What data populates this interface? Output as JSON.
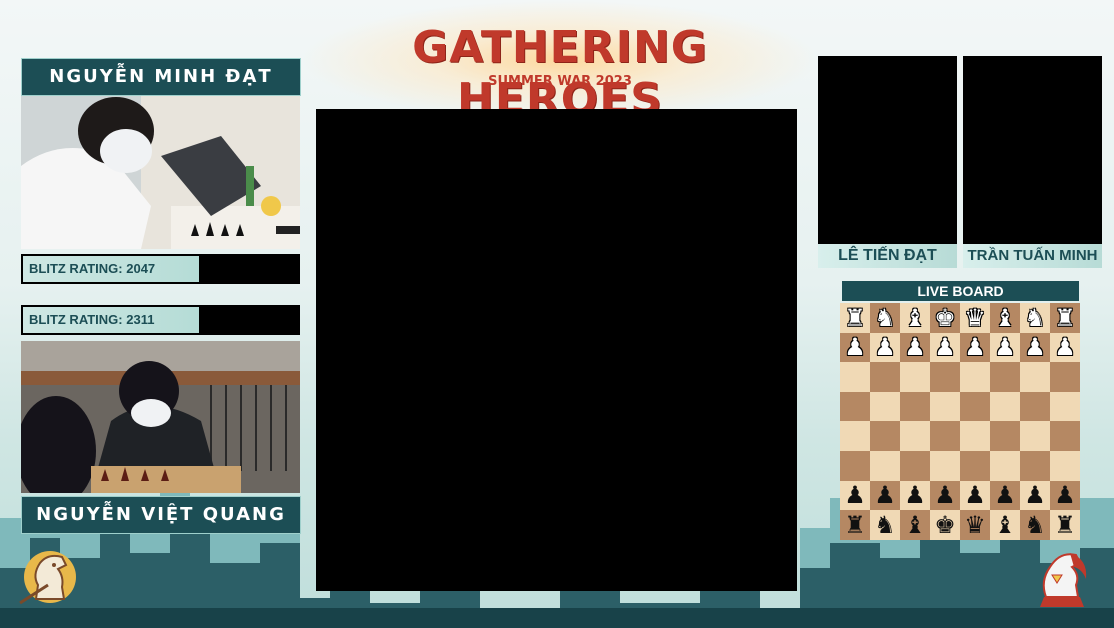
{
  "event": {
    "title": "GATHERING HEROES",
    "subtitle": "SUMMER WAR 2023"
  },
  "players_left": [
    {
      "name": "NGUYỄN MINH ĐẠT",
      "rating": "BLITZ  RATING: 2047"
    },
    {
      "name": "NGUYỄN VIỆT QUANG",
      "rating": "BLITZ  RATING: 2311"
    }
  ],
  "players_right": [
    {
      "name": "LÊ TIẾN ĐẠT"
    },
    {
      "name": "TRẦN TUẤN MINH"
    }
  ],
  "live_board": {
    "title": "LIVE BOARD",
    "rows": [
      [
        "♜",
        "♞",
        "♝",
        "♚",
        "♛",
        "♝",
        "♞",
        "♜"
      ],
      [
        "♟",
        "♟",
        "♟",
        "♟",
        "♟",
        "♟",
        "♟",
        "♟"
      ],
      [
        "",
        "",
        "",
        "",
        "",
        "",
        "",
        ""
      ],
      [
        "",
        "",
        "",
        "",
        "",
        "",
        "",
        ""
      ],
      [
        "",
        "",
        "",
        "",
        "",
        "",
        "",
        ""
      ],
      [
        "",
        "",
        "",
        "",
        "",
        "",
        "",
        ""
      ],
      [
        "♟",
        "♟",
        "♟",
        "♟",
        "♟",
        "♟",
        "♟",
        "♟"
      ],
      [
        "♜",
        "♞",
        "♝",
        "♚",
        "♛",
        "♝",
        "♞",
        "♜"
      ]
    ],
    "row_colors": [
      "white",
      "white",
      "",
      "",
      "",
      "",
      "black",
      "black"
    ]
  },
  "colors": {
    "accent": "#1c4e55",
    "title_red": "#c0392b",
    "board_light": "#f0d9b5",
    "board_dark": "#b58863"
  },
  "icons": {
    "left_logo": "knight-logo-icon",
    "right_logo": "hero-knight-logo-icon"
  }
}
